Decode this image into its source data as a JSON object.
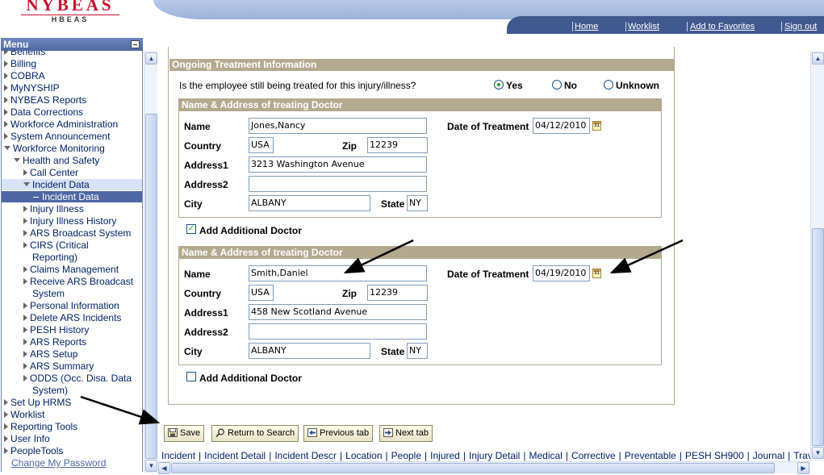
{
  "logo": {
    "main": "NYBEAS",
    "sub": "HBEAS"
  },
  "nav": {
    "home": "Home",
    "worklist": "Worklist",
    "favorites": "Add to Favorites",
    "signout": "Sign out"
  },
  "menu": {
    "title": "Menu",
    "items": [
      {
        "label": "Benefits",
        "level": 0,
        "expanded": false
      },
      {
        "label": "Billing",
        "level": 0,
        "expanded": false
      },
      {
        "label": "COBRA",
        "level": 0,
        "expanded": false
      },
      {
        "label": "MyNYSHIP",
        "level": 0,
        "expanded": false
      },
      {
        "label": "NYBEAS Reports",
        "level": 0,
        "expanded": false
      },
      {
        "label": "Data Corrections",
        "level": 0,
        "expanded": false
      },
      {
        "label": "Workforce Administration",
        "level": 0,
        "expanded": false
      },
      {
        "label": "System Announcement",
        "level": 0,
        "expanded": false
      },
      {
        "label": "Workforce Monitoring",
        "level": 0,
        "expanded": true
      },
      {
        "label": "Health and Safety",
        "level": 1,
        "expanded": true
      },
      {
        "label": "Call Center",
        "level": 2,
        "expanded": false
      },
      {
        "label": "Incident Data",
        "level": 2,
        "expanded": true
      },
      {
        "label": "Incident Data",
        "level": 3,
        "selected": true
      },
      {
        "label": "Injury Illness",
        "level": 2,
        "expanded": false
      },
      {
        "label": "Injury Illness History",
        "level": 2,
        "expanded": false
      },
      {
        "label": "ARS Broadcast System",
        "level": 2,
        "expanded": false
      },
      {
        "label": "CIRS (Critical",
        "cont": "Reporting)",
        "level": 2,
        "expanded": false
      },
      {
        "label": "Claims Management",
        "level": 2,
        "expanded": false
      },
      {
        "label": "Receive ARS Broadcast",
        "cont": "System",
        "level": 2,
        "expanded": false
      },
      {
        "label": "Personal Information",
        "level": 2,
        "expanded": false
      },
      {
        "label": "Delete ARS Incidents",
        "level": 2,
        "expanded": false
      },
      {
        "label": "PESH History",
        "level": 2,
        "expanded": false
      },
      {
        "label": "ARS Reports",
        "level": 2,
        "expanded": false
      },
      {
        "label": "ARS Setup",
        "level": 2,
        "expanded": false
      },
      {
        "label": "ARS Summary",
        "level": 2,
        "expanded": false
      },
      {
        "label": "ODDS (Occ. Disa. Data",
        "cont": "System)",
        "level": 2,
        "expanded": false
      },
      {
        "label": "Set Up HRMS",
        "level": 0,
        "expanded": false
      },
      {
        "label": "Worklist",
        "level": 0,
        "expanded": false
      },
      {
        "label": "Reporting Tools",
        "level": 0,
        "expanded": false
      },
      {
        "label": "User Info",
        "level": 0,
        "expanded": false
      },
      {
        "label": "PeopleTools",
        "level": 0,
        "expanded": false
      },
      {
        "label": "Change My Password",
        "level": 0,
        "link": true
      }
    ]
  },
  "form": {
    "section_title": "Ongoing Treatment Information",
    "question": "Is the employee still being treated for this injury/illness?",
    "options": {
      "yes": "Yes",
      "no": "No",
      "unknown": "Unknown"
    },
    "selected_option": "Yes",
    "labels": {
      "name": "Name",
      "country": "Country",
      "zip": "Zip",
      "address1": "Address1",
      "address2": "Address2",
      "city": "City",
      "state": "State",
      "date": "Date of Treatment"
    },
    "add_doctor_label": "Add Additional Doctor",
    "doctors": [
      {
        "header": "Name & Address of treating Doctor",
        "name": "Jones,Nancy",
        "date": "04/12/2010",
        "country": "USA",
        "zip": "12239",
        "address1": "3213 Washington Avenue",
        "address2": "",
        "city": "ALBANY",
        "state": "NY",
        "add_additional_checked": true
      },
      {
        "header": "Name & Address of treating Doctor",
        "name": "Smith,Daniel",
        "date": "04/19/2010",
        "country": "USA",
        "zip": "12239",
        "address1": "458 New Scotland Avenue",
        "address2": "",
        "city": "ALBANY",
        "state": "NY",
        "add_additional_checked": false
      }
    ]
  },
  "buttons": {
    "save": "Save",
    "return": "Return to Search",
    "previous": "Previous tab",
    "next": "Next tab"
  },
  "tabs": [
    "Incident",
    "Incident Detail",
    "Incident Descr",
    "Location",
    "People",
    "Injured",
    "Injury Detail",
    "Medical",
    "Corrective",
    "Preventable",
    "PESH SH900",
    "Journal",
    "Travel"
  ],
  "colors": {
    "section_header": "#b3a98e",
    "menu_selected": "#4e67a2",
    "nav_bar": "#42598f",
    "arrow": "#000000"
  }
}
